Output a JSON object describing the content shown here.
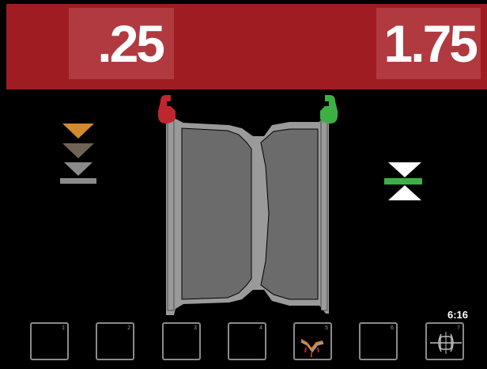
{
  "header": {
    "left_value": ".25",
    "right_value": "1.75",
    "color": "#a01c23"
  },
  "indicators": {
    "left_stack_colors": [
      "#d38a2f",
      "#6e6356",
      "#8a8a8a"
    ],
    "right_center_color": "#3cb043",
    "clamp_left_color": "#c0262d",
    "clamp_right_color": "#3cb043"
  },
  "clock": "6:16",
  "function_keys": [
    {
      "num": "1",
      "icon": "blank"
    },
    {
      "num": "2",
      "icon": "blank"
    },
    {
      "num": "3",
      "icon": "blank"
    },
    {
      "num": "4",
      "icon": "blank"
    },
    {
      "num": "5",
      "icon": "weight-position-icon"
    },
    {
      "num": "6",
      "icon": "blank"
    },
    {
      "num": "7",
      "icon": "wheel-rim-icon"
    }
  ]
}
